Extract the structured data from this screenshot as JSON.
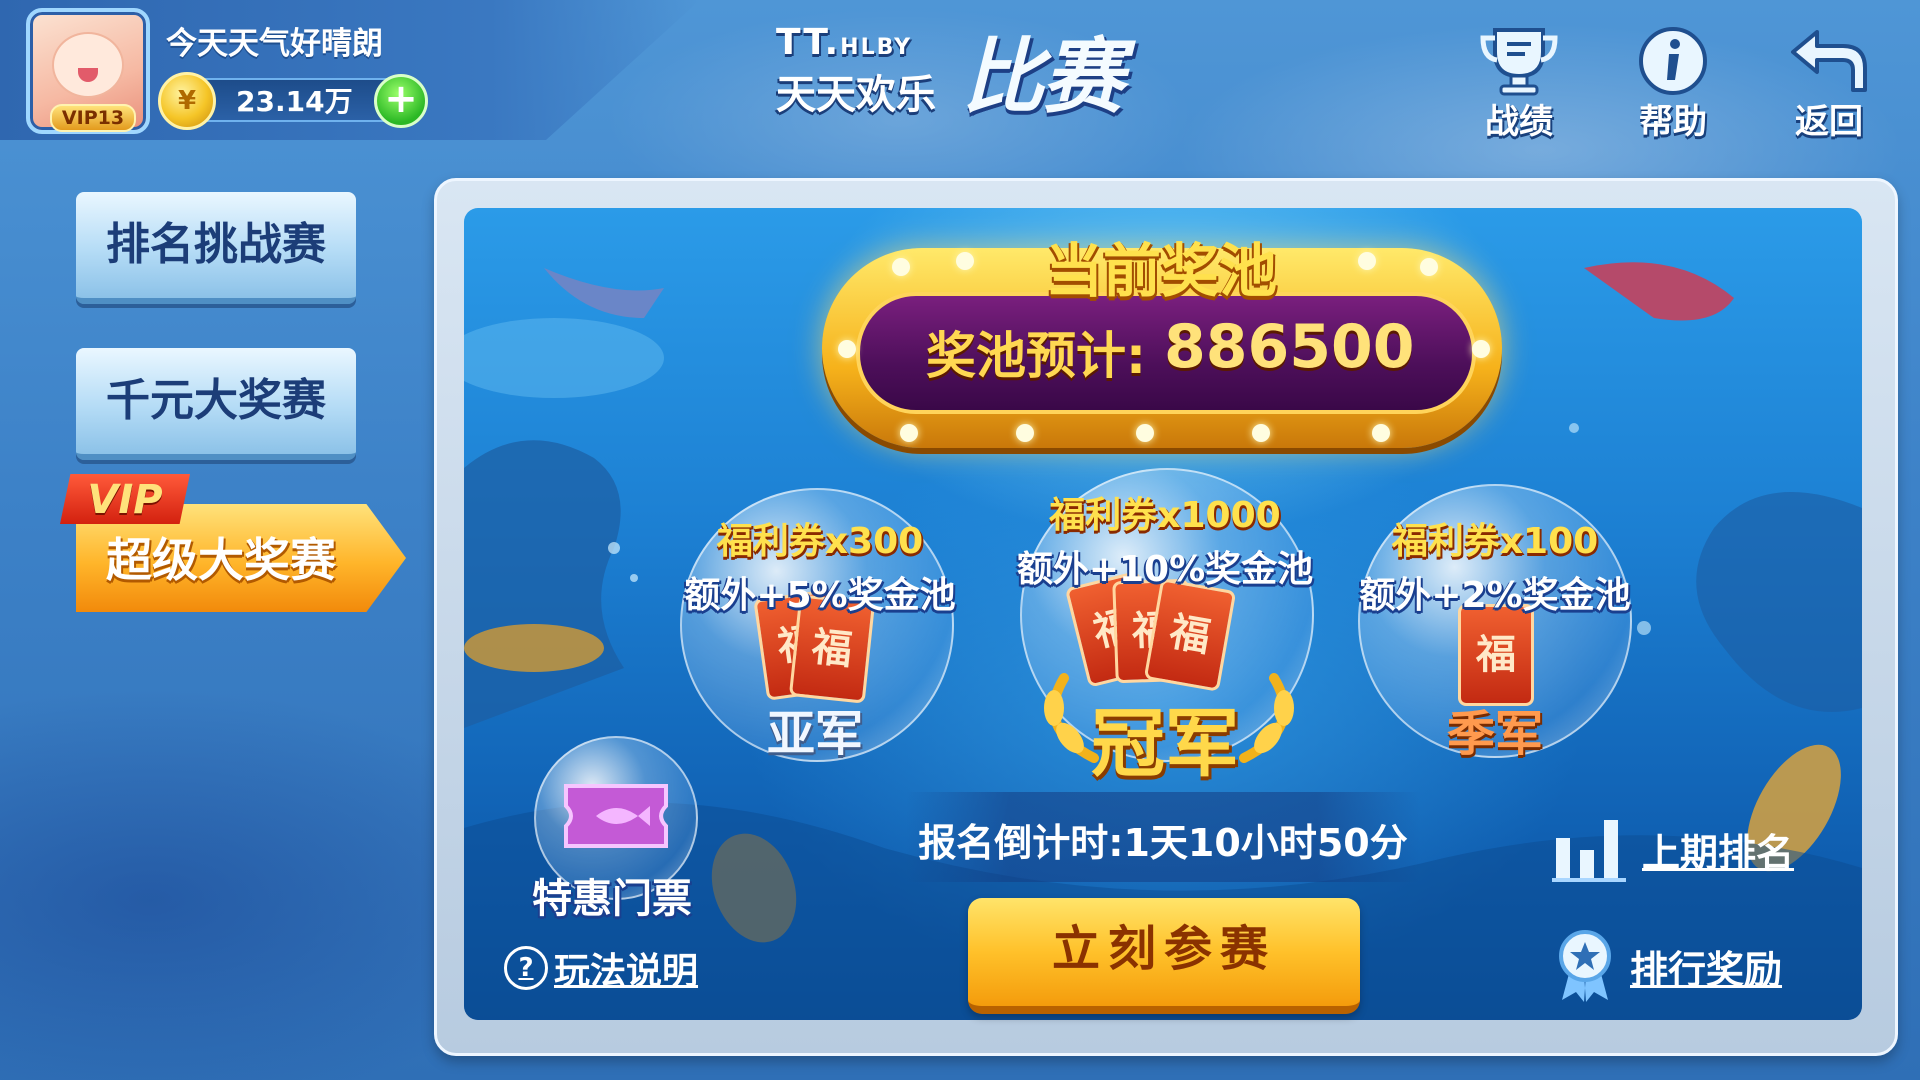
{
  "player": {
    "name": "今天天气好晴朗",
    "vip_level": "VIP13",
    "coins": "23.14万",
    "add_symbol": "+"
  },
  "logo": {
    "small_en": "TT.",
    "small_en2": "HLBY",
    "small_cn": "天天欢乐",
    "big": "比赛"
  },
  "top_buttons": [
    {
      "label": "战绩",
      "icon": "trophy-icon"
    },
    {
      "label": "帮助",
      "icon": "info-icon"
    },
    {
      "label": "返回",
      "icon": "back-arrow-icon"
    }
  ],
  "menu": {
    "items": [
      "排名挑战赛",
      "千元大奖赛"
    ],
    "active": "超级大奖赛",
    "active_flag": "VIP"
  },
  "prize_pool": {
    "title": "当前奖池",
    "label": "奖池预计:",
    "value": "886500"
  },
  "prizes": [
    {
      "coupon": "福利券x300",
      "extra": "额外+5%奖金池",
      "rank": "亚军",
      "card_text": "福"
    },
    {
      "coupon": "福利券x1000",
      "extra": "额外+10%奖金池",
      "rank": "冠军",
      "card_text": "福"
    },
    {
      "coupon": "福利券x100",
      "extra": "额外+2%奖金池",
      "rank": "季军",
      "card_text": "福"
    }
  ],
  "countdown": "报名倒计时:1天10小时50分",
  "join_button": "立刻参赛",
  "ticket_label": "特惠门票",
  "help_link": "玩法说明",
  "last_rank_link": "上期排名",
  "rank_reward_link": "排行奖励",
  "colors": {
    "background": "#3d82c8",
    "gold_button": "#ffc12a",
    "menu_button": "#b5dcf6",
    "pool_purple": "#4d0f5a"
  }
}
